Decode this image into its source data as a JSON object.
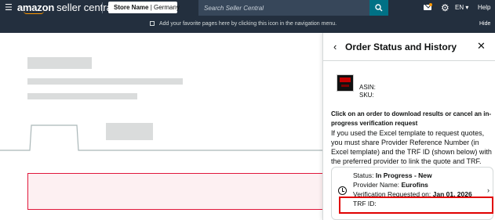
{
  "topnav": {
    "menu_icon": "hamburger-icon",
    "brand_bold": "amazon",
    "brand_rest": "seller central",
    "store_name_label": "Store Name",
    "store_separator": "|",
    "store_country": "Germany",
    "search_placeholder": "Search Seller Central",
    "search_icon": "search-icon",
    "mail_icon": "mail-icon",
    "settings_icon": "gear-icon",
    "language": "EN ▾",
    "help": "Help",
    "background_color": "#232f3e",
    "search_button_color": "#007185"
  },
  "subnav": {
    "message": "Add your favorite pages here by clicking this icon in the navigation menu.",
    "hide_label": "Hide"
  },
  "panel": {
    "back_icon": "chevron-left-icon",
    "title": "Order Status and History",
    "close_icon": "close-icon",
    "asin_label": "ASIN:",
    "sku_label": "SKU:",
    "click_instruction": "Click on an order to download results or cancel an in-progress verification request",
    "excel_instruction": "If you used the Excel template to request quotes, you must share Provider Reference Number (in Excel template) and the TRF ID (shown below) with the preferred provider to link the quote and TRF.",
    "order": {
      "status_label": "Status:",
      "status_value": "In Progress - New",
      "provider_label": "Provider Name:",
      "provider_value": "Eurofins",
      "requested_label": "Verification Requested on:",
      "requested_value": "Jan 01, 2026",
      "trf_label": "TRF ID:",
      "chevron_icon": "chevron-right-icon",
      "status_icon": "clock-icon"
    }
  },
  "colors": {
    "highlight_red": "#e00000",
    "alert_pink": "#fdf0f2",
    "alert_border": "#e0173b",
    "placeholder_gray": "#dadcdc"
  }
}
